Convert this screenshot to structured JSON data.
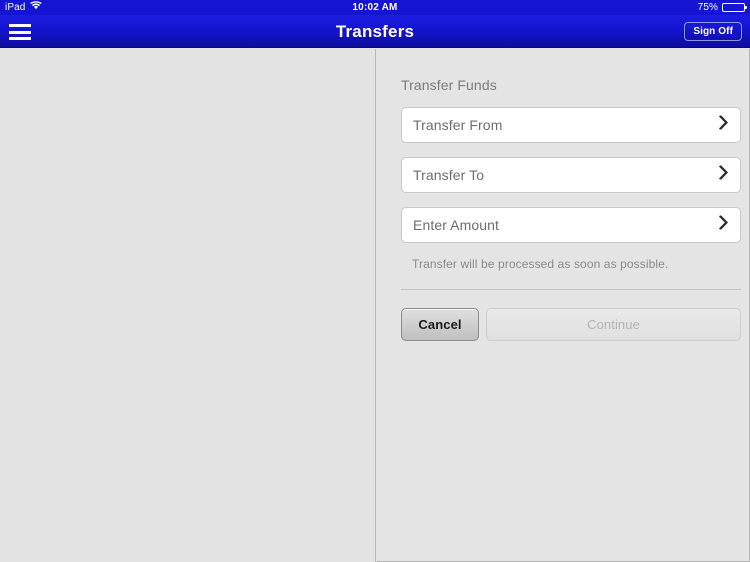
{
  "status_bar": {
    "device": "iPad",
    "wifi_icon": "wifi-icon",
    "time": "10:02 AM",
    "battery_percent": "75%",
    "battery_icon": "battery-icon",
    "battery_level": 75
  },
  "nav_bar": {
    "menu_icon": "hamburger-menu-icon",
    "title": "Transfers",
    "sign_off_label": "Sign Off",
    "background_color": "#1414d2",
    "text_color": "#ffffff"
  },
  "main": {
    "section_title": "Transfer Funds",
    "fields": [
      {
        "label": "Transfer From",
        "chevron_icon": "chevron-right-icon",
        "value": ""
      },
      {
        "label": "Transfer To",
        "chevron_icon": "chevron-right-icon",
        "value": ""
      },
      {
        "label": "Enter Amount",
        "chevron_icon": "chevron-right-icon",
        "value": ""
      }
    ],
    "note": "Transfer will be processed as soon as possible.",
    "buttons": {
      "cancel_label": "Cancel",
      "continue_label": "Continue",
      "continue_disabled": true
    }
  }
}
